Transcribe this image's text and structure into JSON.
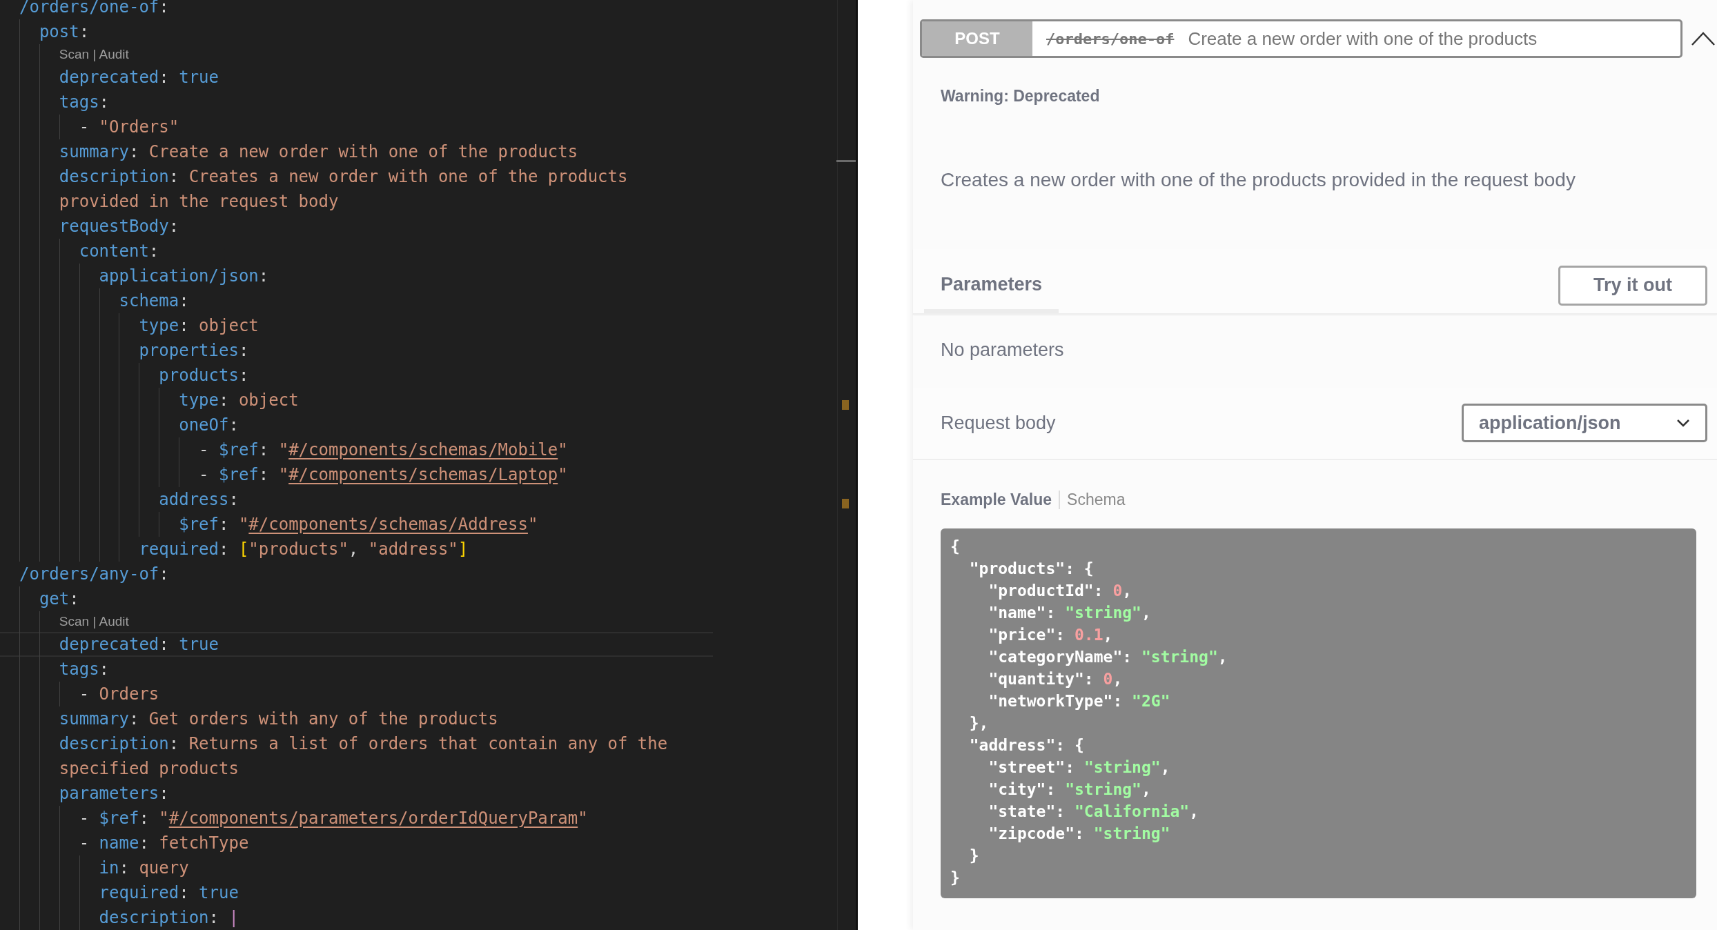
{
  "editor": {
    "lines": [
      {
        "tokens": [
          {
            "kind": "key",
            "text": "/orders/one-of"
          },
          {
            "kind": "punct",
            "text": ":"
          }
        ],
        "children": [
          {
            "tokens": [
              {
                "kind": "key",
                "text": "post"
              },
              {
                "kind": "punct",
                "text": ":"
              }
            ],
            "children": [
              {
                "kind": "codelens",
                "text": "Scan | Audit"
              },
              {
                "tokens": [
                  {
                    "kind": "key",
                    "text": "deprecated"
                  },
                  {
                    "kind": "punct",
                    "text": ": "
                  },
                  {
                    "kind": "bool",
                    "text": "true"
                  }
                ]
              },
              {
                "tokens": [
                  {
                    "kind": "key",
                    "text": "tags"
                  },
                  {
                    "kind": "punct",
                    "text": ":"
                  }
                ],
                "children": [
                  {
                    "tokens": [
                      {
                        "kind": "punct",
                        "text": "- "
                      },
                      {
                        "kind": "string",
                        "text": "\"Orders\""
                      }
                    ]
                  }
                ]
              },
              {
                "tokens": [
                  {
                    "kind": "key",
                    "text": "summary"
                  },
                  {
                    "kind": "punct",
                    "text": ": "
                  },
                  {
                    "kind": "string",
                    "text": "Create a new order with one of the products"
                  }
                ]
              },
              {
                "tokens": [
                  {
                    "kind": "key",
                    "text": "description"
                  },
                  {
                    "kind": "punct",
                    "text": ": "
                  },
                  {
                    "kind": "string",
                    "text": "Creates a new order with one of the products"
                  }
                ]
              },
              {
                "tokens": [
                  {
                    "kind": "string",
                    "text": "provided in the request body"
                  }
                ]
              },
              {
                "tokens": [
                  {
                    "kind": "key",
                    "text": "requestBody"
                  },
                  {
                    "kind": "punct",
                    "text": ":"
                  }
                ],
                "children": [
                  {
                    "tokens": [
                      {
                        "kind": "key",
                        "text": "content"
                      },
                      {
                        "kind": "punct",
                        "text": ":"
                      }
                    ],
                    "children": [
                      {
                        "tokens": [
                          {
                            "kind": "key",
                            "text": "application/json"
                          },
                          {
                            "kind": "punct",
                            "text": ":"
                          }
                        ],
                        "children": [
                          {
                            "tokens": [
                              {
                                "kind": "key",
                                "text": "schema"
                              },
                              {
                                "kind": "punct",
                                "text": ":"
                              }
                            ],
                            "children": [
                              {
                                "tokens": [
                                  {
                                    "kind": "key",
                                    "text": "type"
                                  },
                                  {
                                    "kind": "punct",
                                    "text": ": "
                                  },
                                  {
                                    "kind": "string",
                                    "text": "object"
                                  }
                                ]
                              },
                              {
                                "tokens": [
                                  {
                                    "kind": "key",
                                    "text": "properties"
                                  },
                                  {
                                    "kind": "punct",
                                    "text": ":"
                                  }
                                ],
                                "children": [
                                  {
                                    "tokens": [
                                      {
                                        "kind": "key",
                                        "text": "products"
                                      },
                                      {
                                        "kind": "punct",
                                        "text": ":"
                                      }
                                    ],
                                    "children": [
                                      {
                                        "tokens": [
                                          {
                                            "kind": "key",
                                            "text": "type"
                                          },
                                          {
                                            "kind": "punct",
                                            "text": ": "
                                          },
                                          {
                                            "kind": "string",
                                            "text": "object"
                                          }
                                        ]
                                      },
                                      {
                                        "tokens": [
                                          {
                                            "kind": "key",
                                            "text": "oneOf"
                                          },
                                          {
                                            "kind": "punct",
                                            "text": ":"
                                          }
                                        ],
                                        "children": [
                                          {
                                            "tokens": [
                                              {
                                                "kind": "punct",
                                                "text": "- "
                                              },
                                              {
                                                "kind": "key",
                                                "text": "$ref"
                                              },
                                              {
                                                "kind": "punct",
                                                "text": ": "
                                              },
                                              {
                                                "kind": "string",
                                                "text": "\""
                                              },
                                              {
                                                "kind": "link",
                                                "text": "#/components/schemas/Mobile"
                                              },
                                              {
                                                "kind": "string",
                                                "text": "\""
                                              }
                                            ]
                                          },
                                          {
                                            "tokens": [
                                              {
                                                "kind": "punct",
                                                "text": "- "
                                              },
                                              {
                                                "kind": "key",
                                                "text": "$ref"
                                              },
                                              {
                                                "kind": "punct",
                                                "text": ": "
                                              },
                                              {
                                                "kind": "string",
                                                "text": "\""
                                              },
                                              {
                                                "kind": "link",
                                                "text": "#/components/schemas/Laptop"
                                              },
                                              {
                                                "kind": "string",
                                                "text": "\""
                                              }
                                            ]
                                          }
                                        ]
                                      }
                                    ]
                                  },
                                  {
                                    "tokens": [
                                      {
                                        "kind": "key",
                                        "text": "address"
                                      },
                                      {
                                        "kind": "punct",
                                        "text": ":"
                                      }
                                    ],
                                    "children": [
                                      {
                                        "tokens": [
                                          {
                                            "kind": "key",
                                            "text": "$ref"
                                          },
                                          {
                                            "kind": "punct",
                                            "text": ": "
                                          },
                                          {
                                            "kind": "string",
                                            "text": "\""
                                          },
                                          {
                                            "kind": "link",
                                            "text": "#/components/schemas/Address"
                                          },
                                          {
                                            "kind": "string",
                                            "text": "\""
                                          }
                                        ]
                                      }
                                    ]
                                  }
                                ]
                              },
                              {
                                "tokens": [
                                  {
                                    "kind": "key",
                                    "text": "required"
                                  },
                                  {
                                    "kind": "punct",
                                    "text": ": "
                                  },
                                  {
                                    "kind": "bracket",
                                    "text": "["
                                  },
                                  {
                                    "kind": "string",
                                    "text": "\"products\""
                                  },
                                  {
                                    "kind": "punct",
                                    "text": ", "
                                  },
                                  {
                                    "kind": "string",
                                    "text": "\"address\""
                                  },
                                  {
                                    "kind": "bracket",
                                    "text": "]"
                                  }
                                ]
                              }
                            ]
                          }
                        ]
                      }
                    ]
                  }
                ]
              }
            ]
          }
        ]
      },
      {
        "tokens": [
          {
            "kind": "key",
            "text": "/orders/any-of"
          },
          {
            "kind": "punct",
            "text": ":"
          }
        ],
        "children": [
          {
            "tokens": [
              {
                "kind": "key",
                "text": "get"
              },
              {
                "kind": "punct",
                "text": ":"
              }
            ],
            "children": [
              {
                "kind": "codelens",
                "text": "Scan | Audit"
              },
              {
                "current": true,
                "tokens": [
                  {
                    "kind": "key",
                    "text": "deprecated"
                  },
                  {
                    "kind": "punct",
                    "text": ": "
                  },
                  {
                    "kind": "bool",
                    "text": "true"
                  }
                ]
              },
              {
                "tokens": [
                  {
                    "kind": "key",
                    "text": "tags"
                  },
                  {
                    "kind": "punct",
                    "text": ":"
                  }
                ],
                "children": [
                  {
                    "tokens": [
                      {
                        "kind": "punct",
                        "text": "- "
                      },
                      {
                        "kind": "string",
                        "text": "Orders"
                      }
                    ]
                  }
                ]
              },
              {
                "tokens": [
                  {
                    "kind": "key",
                    "text": "summary"
                  },
                  {
                    "kind": "punct",
                    "text": ": "
                  },
                  {
                    "kind": "string",
                    "text": "Get orders with any of the products"
                  }
                ]
              },
              {
                "tokens": [
                  {
                    "kind": "key",
                    "text": "description"
                  },
                  {
                    "kind": "punct",
                    "text": ": "
                  },
                  {
                    "kind": "string",
                    "text": "Returns a list of orders that contain any of the"
                  }
                ]
              },
              {
                "tokens": [
                  {
                    "kind": "string",
                    "text": "specified products"
                  }
                ]
              },
              {
                "tokens": [
                  {
                    "kind": "key",
                    "text": "parameters"
                  },
                  {
                    "kind": "punct",
                    "text": ":"
                  }
                ],
                "children": [
                  {
                    "tokens": [
                      {
                        "kind": "punct",
                        "text": "- "
                      },
                      {
                        "kind": "key",
                        "text": "$ref"
                      },
                      {
                        "kind": "punct",
                        "text": ": "
                      },
                      {
                        "kind": "string",
                        "text": "\""
                      },
                      {
                        "kind": "link",
                        "text": "#/components/parameters/orderIdQueryParam"
                      },
                      {
                        "kind": "string",
                        "text": "\""
                      }
                    ]
                  },
                  {
                    "tokens": [
                      {
                        "kind": "punct",
                        "text": "- "
                      },
                      {
                        "kind": "key",
                        "text": "name"
                      },
                      {
                        "kind": "punct",
                        "text": ": "
                      },
                      {
                        "kind": "string",
                        "text": "fetchType"
                      }
                    ],
                    "children": [
                      {
                        "tokens": [
                          {
                            "kind": "key",
                            "text": "in"
                          },
                          {
                            "kind": "punct",
                            "text": ": "
                          },
                          {
                            "kind": "string",
                            "text": "query"
                          }
                        ]
                      },
                      {
                        "tokens": [
                          {
                            "kind": "key",
                            "text": "required"
                          },
                          {
                            "kind": "punct",
                            "text": ": "
                          },
                          {
                            "kind": "bool",
                            "text": "true"
                          }
                        ]
                      },
                      {
                        "tokens": [
                          {
                            "kind": "key",
                            "text": "description"
                          },
                          {
                            "kind": "punct",
                            "text": ": "
                          },
                          {
                            "kind": "operator",
                            "text": "|"
                          }
                        ]
                      }
                    ]
                  }
                ]
              }
            ]
          }
        ]
      }
    ]
  },
  "operation": {
    "method": "POST",
    "path": "/orders/one-of",
    "deprecated": true,
    "summary": "Create a new order with one of the products",
    "expanded": true,
    "warning": "Warning: Deprecated",
    "description": "Creates a new order with one of the products provided in the request body",
    "parameters_title": "Parameters",
    "try_button": "Try it out",
    "no_parameters": "No parameters",
    "request_body_label": "Request body",
    "content_type": "application/json",
    "example_tabs": [
      {
        "label": "Example Value",
        "selected": true
      },
      {
        "label": "Schema",
        "selected": false
      }
    ],
    "example_lines": [
      [
        {
          "kind": "plain",
          "text": "{"
        }
      ],
      [
        {
          "kind": "plain",
          "text": "  \"products\": {"
        }
      ],
      [
        {
          "kind": "plain",
          "text": "    \"productId\": "
        },
        {
          "kind": "number",
          "text": "0"
        },
        {
          "kind": "plain",
          "text": ","
        }
      ],
      [
        {
          "kind": "plain",
          "text": "    \"name\": "
        },
        {
          "kind": "string",
          "text": "\"string\""
        },
        {
          "kind": "plain",
          "text": ","
        }
      ],
      [
        {
          "kind": "plain",
          "text": "    \"price\": "
        },
        {
          "kind": "number",
          "text": "0.1"
        },
        {
          "kind": "plain",
          "text": ","
        }
      ],
      [
        {
          "kind": "plain",
          "text": "    \"categoryName\": "
        },
        {
          "kind": "string",
          "text": "\"string\""
        },
        {
          "kind": "plain",
          "text": ","
        }
      ],
      [
        {
          "kind": "plain",
          "text": "    \"quantity\": "
        },
        {
          "kind": "number",
          "text": "0"
        },
        {
          "kind": "plain",
          "text": ","
        }
      ],
      [
        {
          "kind": "plain",
          "text": "    \"networkType\": "
        },
        {
          "kind": "string",
          "text": "\"2G\""
        }
      ],
      [
        {
          "kind": "plain",
          "text": "  },"
        }
      ],
      [
        {
          "kind": "plain",
          "text": "  \"address\": {"
        }
      ],
      [
        {
          "kind": "plain",
          "text": "    \"street\": "
        },
        {
          "kind": "string",
          "text": "\"string\""
        },
        {
          "kind": "plain",
          "text": ","
        }
      ],
      [
        {
          "kind": "plain",
          "text": "    \"city\": "
        },
        {
          "kind": "string",
          "text": "\"string\""
        },
        {
          "kind": "plain",
          "text": ","
        }
      ],
      [
        {
          "kind": "plain",
          "text": "    \"state\": "
        },
        {
          "kind": "string",
          "text": "\"California\""
        },
        {
          "kind": "plain",
          "text": ","
        }
      ],
      [
        {
          "kind": "plain",
          "text": "    \"zipcode\": "
        },
        {
          "kind": "string",
          "text": "\"string\""
        }
      ],
      [
        {
          "kind": "plain",
          "text": "  }"
        }
      ],
      [
        {
          "kind": "plain",
          "text": "}"
        }
      ]
    ]
  }
}
